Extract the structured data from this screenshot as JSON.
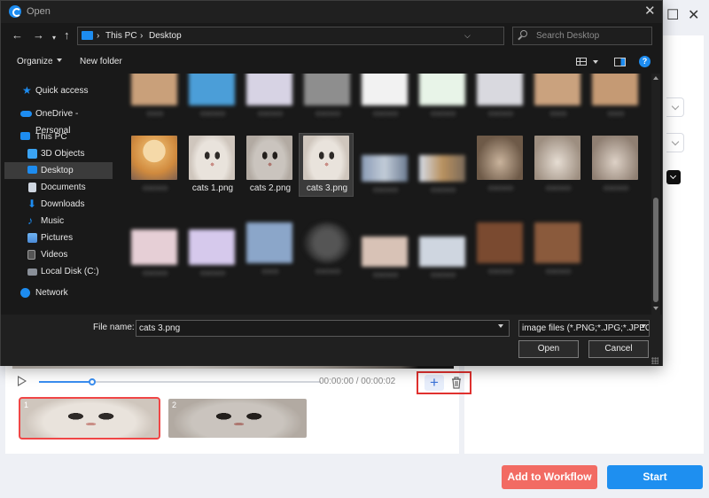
{
  "dialog": {
    "title": "Open",
    "breadcrumb": [
      "This PC",
      "Desktop"
    ],
    "search_placeholder": "Search Desktop",
    "toolbar": {
      "organize": "Organize",
      "new_folder": "New folder"
    },
    "sidebar": [
      {
        "label": "Quick access",
        "icon": "star-icon"
      },
      {
        "label": "OneDrive - Personal",
        "icon": "cloud-icon"
      },
      {
        "label": "This PC",
        "icon": "monitor-icon"
      },
      {
        "label": "3D Objects",
        "icon": "cube-icon"
      },
      {
        "label": "Desktop",
        "icon": "desktop-icon",
        "selected": true
      },
      {
        "label": "Documents",
        "icon": "document-icon"
      },
      {
        "label": "Downloads",
        "icon": "download-icon"
      },
      {
        "label": "Music",
        "icon": "music-icon"
      },
      {
        "label": "Pictures",
        "icon": "picture-icon"
      },
      {
        "label": "Videos",
        "icon": "video-icon"
      },
      {
        "label": "Local Disk (C:)",
        "icon": "drive-icon"
      },
      {
        "label": "Network",
        "icon": "network-icon"
      }
    ],
    "files": [
      {
        "name": "cats 1.png"
      },
      {
        "name": "cats 2.png"
      },
      {
        "name": "cats 3.png",
        "selected": true
      }
    ],
    "file_name_label": "File name:",
    "file_name_value": "cats 3.png",
    "file_type": "image files (*.PNG;*.JPG;*.JPEG;",
    "open_label": "Open",
    "cancel_label": "Cancel"
  },
  "editor": {
    "time_text": "00:00:00 / 00:00:02",
    "progress": 0.19,
    "clips": [
      {
        "index": "1",
        "selected": true
      },
      {
        "index": "2"
      }
    ],
    "add_to_workflow": "Add to Workflow",
    "start": "Start"
  },
  "colors": {
    "accent": "#1e8ff0",
    "danger": "#f26b63",
    "highlight_border": "#e0312f"
  }
}
